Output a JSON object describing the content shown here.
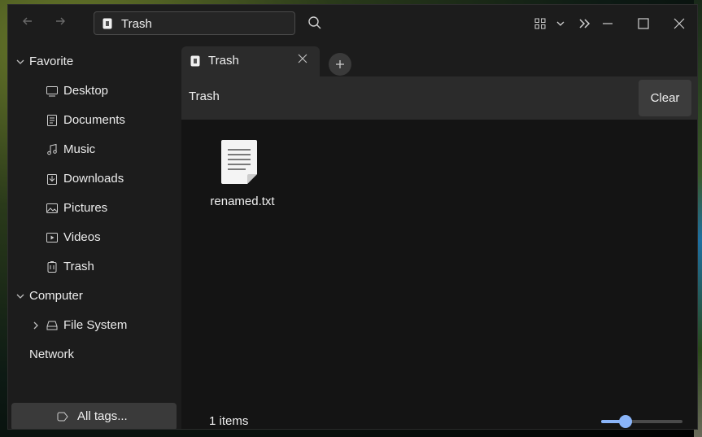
{
  "titlebar": {
    "back_icon": "arrow-left-icon",
    "forward_icon": "arrow-right-icon",
    "address": "Trash",
    "search_icon": "search-icon",
    "view_icon": "grid-view-icon",
    "more_icon": "chevrons-right-icon"
  },
  "sidebar": {
    "favorite_label": "Favorite",
    "items": [
      {
        "label": "Desktop",
        "icon": "desktop-icon"
      },
      {
        "label": "Documents",
        "icon": "document-icon"
      },
      {
        "label": "Music",
        "icon": "music-icon"
      },
      {
        "label": "Downloads",
        "icon": "download-icon"
      },
      {
        "label": "Pictures",
        "icon": "picture-icon"
      },
      {
        "label": "Videos",
        "icon": "video-icon"
      },
      {
        "label": "Trash",
        "icon": "trash-icon"
      }
    ],
    "computer_label": "Computer",
    "filesystem_label": "File System",
    "network_label": "Network",
    "tags_label": "All tags..."
  },
  "tabs": [
    {
      "label": "Trash"
    }
  ],
  "pathbar": {
    "label": "Trash",
    "clear_label": "Clear"
  },
  "files": [
    {
      "name": "renamed.txt",
      "icon": "text-file-icon"
    }
  ],
  "status": {
    "items_text": "1 items",
    "zoom_fraction": 0.3
  },
  "colors": {
    "accent": "#8ab4f8",
    "window_bg": "#1c1c1c",
    "content_bg": "#141414"
  }
}
